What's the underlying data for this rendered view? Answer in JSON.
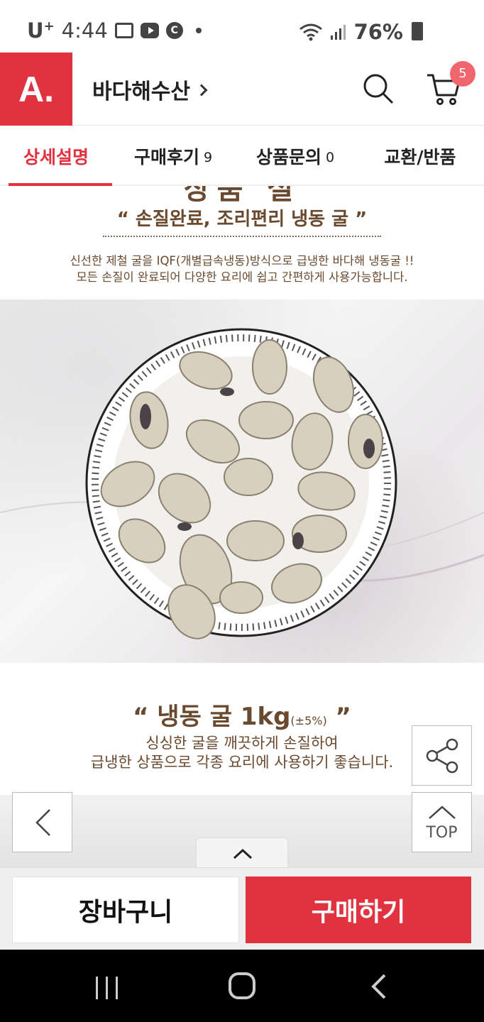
{
  "status_bar": {
    "carrier": "U",
    "carrier_sup": "+",
    "time": "4:44",
    "battery": "76%"
  },
  "header": {
    "logo_text": "A.",
    "shop_name": "바다해수산",
    "cart_count": "5"
  },
  "tabs": [
    {
      "label": "상세설명",
      "count": ""
    },
    {
      "label": "구매후기",
      "count": "9"
    },
    {
      "label": "상품문의",
      "count": "0"
    },
    {
      "label": "교환/반품",
      "count": ""
    }
  ],
  "content": {
    "cut_title": "상품 설",
    "quote1": "“ 손질완료, 조리편리 냉동 굴 ”",
    "desc1_line1": "신선한 제철 굴을 IQF(개별급속냉동)방식으로 급냉한 바다해 냉동굴 !!",
    "desc1_line2": "모든 손질이 완료되어 다양한 요리에 쉽고 간편하게 사용가능합니다.",
    "quote2_main": "“ 냉동 굴 1kg",
    "quote2_small": "(±5%)",
    "quote2_end": " ”",
    "desc2_line1": "싱싱한 굴을 깨끗하게 손질하여",
    "desc2_line2": "급냉한 상품으로 각종 요리에 사용하기 좋습니다."
  },
  "floating": {
    "top_label": "TOP"
  },
  "bottom_bar": {
    "cart_label": "장바구니",
    "buy_label": "구매하기"
  },
  "colors": {
    "brand_red": "#e13240",
    "brown_text": "#6a4a2f"
  }
}
